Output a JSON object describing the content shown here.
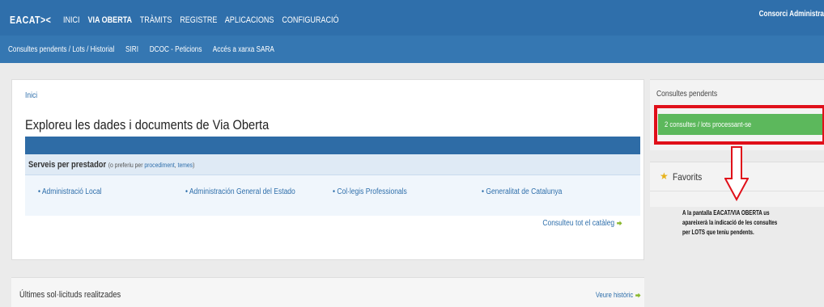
{
  "header": {
    "brand": "EACAT><",
    "nav": [
      "INICI",
      "VIA OBERTA",
      "TRÀMITS",
      "REGISTRE",
      "APLICACIONS",
      "CONFIGURACIÓ"
    ],
    "user": "Consorci Administra"
  },
  "subnav": [
    "Consultes pendents / Lots / Historial",
    "SIRI",
    "DCOC - Peticions",
    "Accés a xarxa SARA"
  ],
  "main": {
    "breadcrumb": "Inici",
    "title": "Exploreu les dades i documents de Via Oberta",
    "services": {
      "title": "Serveis per prestador",
      "hint_prefix": "(o preferiu per ",
      "hint_link1": "procediment",
      "hint_sep": ", ",
      "hint_link2": "temes",
      "hint_suffix": ")",
      "items": [
        "Administració Local",
        "Administración General del Estado",
        "Col·legis Professionals",
        "Generalitat de Catalunya"
      ]
    },
    "catalog_link": "Consulteu tot el catàleg"
  },
  "recent": {
    "title": "Últimes sol·licituds realitzades",
    "history_link": "Veure històric"
  },
  "sidebar": {
    "pending_title": "Consultes pendents",
    "pending_badge": "2 consultes / lots processant-se",
    "favorites_title": "Favorits",
    "note_lines": [
      "A la pantalla EACAT/VIA OBERTA us",
      "apareixerà la indicació de les consultes",
      "per LOTS que teniu pendents."
    ]
  },
  "colors": {
    "header": "#2f6fab",
    "badge": "#5cb85c",
    "highlight": "#e0101a"
  }
}
